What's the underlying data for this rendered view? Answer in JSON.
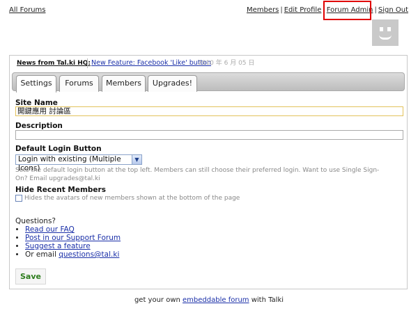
{
  "header": {
    "all_forums": "All Forums",
    "nav": {
      "members": "Members",
      "edit_profile": "Edit Profile",
      "forum_admin": "Forum Admin",
      "sign_out": "Sign Out",
      "separator": "|"
    },
    "highlight_color": "#e00000"
  },
  "news": {
    "label": "News from Tal.ki HQ:",
    "link": "New Feature: Facebook 'Like' button",
    "date": "2010 年 6 月 05 日"
  },
  "tabs": [
    {
      "label": "Settings",
      "active": true
    },
    {
      "label": "Forums",
      "active": false
    },
    {
      "label": "Members",
      "active": false
    },
    {
      "label": "Upgrades!",
      "active": false
    }
  ],
  "form": {
    "site_name": {
      "label": "Site Name",
      "value": "開鍵應用 討論區"
    },
    "description": {
      "label": "Description",
      "value": ""
    },
    "default_login": {
      "label": "Default Login Button",
      "selected": "Login with existing (Multiple Icons)",
      "help": "Sets the default login button at the top left. Members can still choose their preferred login. Want to use Single Sign-On? Email upgrades@tal.ki"
    },
    "hide_recent": {
      "label": "Hide Recent Members",
      "checked": false,
      "help": "Hides the avatars of new members shown at the bottom of the page"
    },
    "save_label": "Save"
  },
  "questions": {
    "title": "Questions?",
    "items": [
      {
        "text": "Read our FAQ",
        "is_link": true
      },
      {
        "text": "Post in our Support Forum",
        "is_link": true
      },
      {
        "text": "Suggest a feature",
        "is_link": true
      }
    ],
    "email_prefix": "Or email ",
    "email": "questions@tal.ki"
  },
  "footer": {
    "before": "get your own ",
    "link": "embeddable forum",
    "after": " with Talki"
  },
  "colors": {
    "link": "#1a2fa8",
    "save_text": "#2e7d1e",
    "site_name_border": "#e3c25b"
  }
}
